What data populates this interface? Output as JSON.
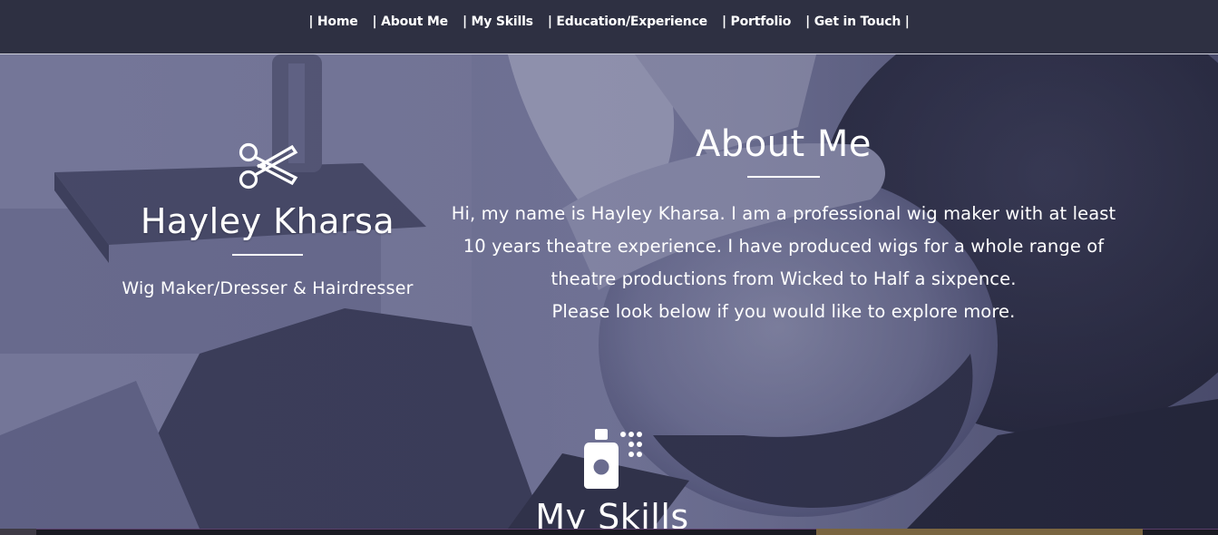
{
  "nav": {
    "items": [
      {
        "label": "| Home"
      },
      {
        "label": "| About Me"
      },
      {
        "label": "| My Skills"
      },
      {
        "label": "| Education/Experience"
      },
      {
        "label": "| Portfolio"
      },
      {
        "label": "| Get in Touch |"
      }
    ]
  },
  "profile": {
    "icon": "scissors-icon",
    "name": "Hayley Kharsa",
    "role": "Wig Maker/Dresser & Hairdresser"
  },
  "about": {
    "title": "About Me",
    "paragraphs": [
      "Hi, my name is Hayley Kharsa. I am a professional wig maker with at least 10 years theatre experience. I have produced wigs for a whole range of theatre productions from Wicked to Half a sixpence.",
      "Please look below if you would like to explore more."
    ]
  },
  "skills": {
    "icon": "spray-bottle-icon",
    "title": "My Skills"
  },
  "colors": {
    "nav_bg": "#2e3042",
    "text": "#ffffff",
    "hero_tint": "#6a6c8f"
  }
}
